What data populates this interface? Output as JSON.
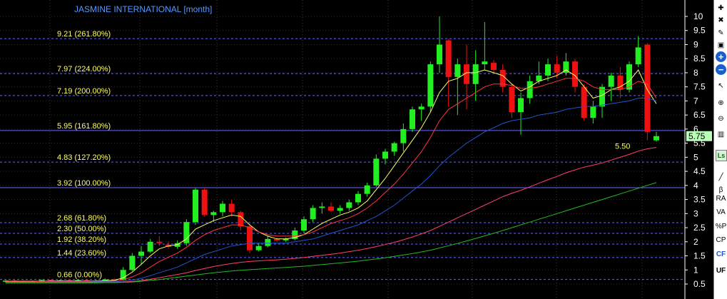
{
  "chart_data": {
    "type": "candlestick",
    "title": "JASMINE INTERNATIONAL [month]",
    "ylim": [
      0.3,
      10.4
    ],
    "y_ticks": [
      0.5,
      1,
      1.5,
      2,
      2.5,
      3,
      3.5,
      4,
      4.5,
      5,
      5.5,
      6,
      6.5,
      7,
      7.5,
      8,
      8.5,
      9,
      9.5,
      10
    ],
    "grid": true,
    "last_price": 5.75,
    "marker_label": "5.50",
    "fib_levels": [
      {
        "value": 9.21,
        "label": "9.21 (261.80%)"
      },
      {
        "value": 7.97,
        "label": "7.97 (224.00%)"
      },
      {
        "value": 7.19,
        "label": "7.19 (200.00%)"
      },
      {
        "value": 5.95,
        "label": "5.95 (161.80%)"
      },
      {
        "value": 4.83,
        "label": "4.83 (127.20%)"
      },
      {
        "value": 3.92,
        "label": "3.92 (100.00%)"
      },
      {
        "value": 2.68,
        "label": "2.68 (61.80%)"
      },
      {
        "value": 2.3,
        "label": "2.30 (50.00%)"
      },
      {
        "value": 1.92,
        "label": "1.92 (38.20%)"
      },
      {
        "value": 1.44,
        "label": "1.44 (23.60%)"
      },
      {
        "value": 0.66,
        "label": "0.66 (0.00%)"
      }
    ],
    "candles": [
      {
        "o": 0.58,
        "h": 0.64,
        "l": 0.54,
        "c": 0.62
      },
      {
        "o": 0.62,
        "h": 0.66,
        "l": 0.56,
        "c": 0.58
      },
      {
        "o": 0.58,
        "h": 0.62,
        "l": 0.55,
        "c": 0.6
      },
      {
        "o": 0.6,
        "h": 0.63,
        "l": 0.56,
        "c": 0.57
      },
      {
        "o": 0.57,
        "h": 0.66,
        "l": 0.55,
        "c": 0.64
      },
      {
        "o": 0.64,
        "h": 0.66,
        "l": 0.58,
        "c": 0.6
      },
      {
        "o": 0.6,
        "h": 0.65,
        "l": 0.57,
        "c": 0.63
      },
      {
        "o": 0.63,
        "h": 0.67,
        "l": 0.56,
        "c": 0.58
      },
      {
        "o": 0.58,
        "h": 0.66,
        "l": 0.55,
        "c": 0.64
      },
      {
        "o": 0.64,
        "h": 0.66,
        "l": 0.58,
        "c": 0.61
      },
      {
        "o": 0.61,
        "h": 0.65,
        "l": 0.56,
        "c": 0.62
      },
      {
        "o": 0.62,
        "h": 0.7,
        "l": 0.58,
        "c": 0.66
      },
      {
        "o": 0.66,
        "h": 0.7,
        "l": 0.6,
        "c": 0.64
      },
      {
        "o": 0.64,
        "h": 1.1,
        "l": 0.62,
        "c": 1.0
      },
      {
        "o": 1.0,
        "h": 1.6,
        "l": 0.95,
        "c": 1.5
      },
      {
        "o": 1.5,
        "h": 1.85,
        "l": 1.2,
        "c": 1.65
      },
      {
        "o": 1.65,
        "h": 2.1,
        "l": 1.6,
        "c": 2.0
      },
      {
        "o": 2.0,
        "h": 2.2,
        "l": 1.85,
        "c": 1.95
      },
      {
        "o": 1.9,
        "h": 2.0,
        "l": 1.75,
        "c": 1.82
      },
      {
        "o": 1.82,
        "h": 2.05,
        "l": 1.75,
        "c": 1.95
      },
      {
        "o": 1.95,
        "h": 2.8,
        "l": 1.85,
        "c": 2.7
      },
      {
        "o": 2.7,
        "h": 3.9,
        "l": 2.6,
        "c": 3.85
      },
      {
        "o": 3.85,
        "h": 3.9,
        "l": 2.9,
        "c": 2.95
      },
      {
        "o": 2.95,
        "h": 3.1,
        "l": 2.7,
        "c": 3.05
      },
      {
        "o": 3.05,
        "h": 3.45,
        "l": 2.9,
        "c": 3.35
      },
      {
        "o": 3.35,
        "h": 3.5,
        "l": 2.9,
        "c": 3.05
      },
      {
        "o": 3.05,
        "h": 3.1,
        "l": 2.4,
        "c": 2.55
      },
      {
        "o": 2.55,
        "h": 2.65,
        "l": 1.6,
        "c": 1.7
      },
      {
        "o": 1.7,
        "h": 1.95,
        "l": 1.65,
        "c": 1.85
      },
      {
        "o": 1.85,
        "h": 2.2,
        "l": 1.8,
        "c": 2.1
      },
      {
        "o": 2.1,
        "h": 2.15,
        "l": 2.0,
        "c": 2.05
      },
      {
        "o": 2.05,
        "h": 2.15,
        "l": 2.0,
        "c": 2.1
      },
      {
        "o": 2.1,
        "h": 2.5,
        "l": 2.05,
        "c": 2.4
      },
      {
        "o": 2.4,
        "h": 2.9,
        "l": 2.3,
        "c": 2.8
      },
      {
        "o": 2.8,
        "h": 3.3,
        "l": 2.7,
        "c": 3.2
      },
      {
        "o": 3.2,
        "h": 3.4,
        "l": 3.0,
        "c": 3.25
      },
      {
        "o": 3.25,
        "h": 3.4,
        "l": 3.05,
        "c": 3.1
      },
      {
        "o": 3.1,
        "h": 3.3,
        "l": 3.0,
        "c": 3.2
      },
      {
        "o": 3.2,
        "h": 3.5,
        "l": 3.1,
        "c": 3.4
      },
      {
        "o": 3.4,
        "h": 3.8,
        "l": 3.3,
        "c": 3.7
      },
      {
        "o": 3.7,
        "h": 4.1,
        "l": 3.6,
        "c": 4.0
      },
      {
        "o": 4.0,
        "h": 5.1,
        "l": 3.95,
        "c": 4.95
      },
      {
        "o": 4.95,
        "h": 5.3,
        "l": 4.75,
        "c": 5.2
      },
      {
        "o": 5.2,
        "h": 5.55,
        "l": 5.05,
        "c": 5.5
      },
      {
        "o": 5.5,
        "h": 6.2,
        "l": 5.2,
        "c": 6.0
      },
      {
        "o": 6.0,
        "h": 6.8,
        "l": 5.9,
        "c": 6.7
      },
      {
        "o": 6.7,
        "h": 6.9,
        "l": 6.3,
        "c": 6.8
      },
      {
        "o": 6.8,
        "h": 8.4,
        "l": 6.6,
        "c": 8.3
      },
      {
        "o": 8.3,
        "h": 10.0,
        "l": 8.0,
        "c": 9.0
      },
      {
        "o": 9.15,
        "h": 9.2,
        "l": 6.8,
        "c": 7.85
      },
      {
        "o": 7.85,
        "h": 8.5,
        "l": 6.5,
        "c": 8.3
      },
      {
        "o": 8.3,
        "h": 9.0,
        "l": 6.7,
        "c": 7.6
      },
      {
        "o": 7.6,
        "h": 8.8,
        "l": 7.0,
        "c": 8.3
      },
      {
        "o": 8.3,
        "h": 9.8,
        "l": 8.1,
        "c": 8.4
      },
      {
        "o": 8.35,
        "h": 8.45,
        "l": 8.0,
        "c": 8.1
      },
      {
        "o": 8.1,
        "h": 8.3,
        "l": 7.3,
        "c": 7.5
      },
      {
        "o": 7.5,
        "h": 7.6,
        "l": 6.4,
        "c": 6.6
      },
      {
        "o": 6.6,
        "h": 7.3,
        "l": 5.8,
        "c": 7.1
      },
      {
        "o": 7.1,
        "h": 7.9,
        "l": 6.9,
        "c": 7.7
      },
      {
        "o": 7.7,
        "h": 8.4,
        "l": 7.6,
        "c": 7.9
      },
      {
        "o": 7.9,
        "h": 8.5,
        "l": 7.7,
        "c": 8.3
      },
      {
        "o": 8.3,
        "h": 8.6,
        "l": 7.8,
        "c": 8.0
      },
      {
        "o": 8.0,
        "h": 8.7,
        "l": 7.9,
        "c": 8.4
      },
      {
        "o": 8.4,
        "h": 8.5,
        "l": 7.3,
        "c": 7.5
      },
      {
        "o": 7.5,
        "h": 7.6,
        "l": 6.3,
        "c": 6.4
      },
      {
        "o": 6.4,
        "h": 7.0,
        "l": 6.2,
        "c": 6.8
      },
      {
        "o": 6.8,
        "h": 7.6,
        "l": 6.4,
        "c": 7.5
      },
      {
        "o": 7.5,
        "h": 8.0,
        "l": 7.0,
        "c": 7.9
      },
      {
        "o": 7.9,
        "h": 8.2,
        "l": 7.1,
        "c": 7.4
      },
      {
        "o": 7.4,
        "h": 8.4,
        "l": 7.3,
        "c": 8.3
      },
      {
        "o": 8.3,
        "h": 9.3,
        "l": 8.2,
        "c": 8.9
      },
      {
        "o": 9.0,
        "h": 9.05,
        "l": 5.6,
        "c": 5.9
      },
      {
        "o": 5.6,
        "h": 5.9,
        "l": 5.55,
        "c": 5.75
      }
    ],
    "ma_series": [
      {
        "color": "#ffff66",
        "values": [
          0.6,
          0.6,
          0.6,
          0.6,
          0.6,
          0.61,
          0.61,
          0.61,
          0.61,
          0.61,
          0.61,
          0.62,
          0.63,
          0.72,
          0.92,
          1.2,
          1.5,
          1.75,
          1.85,
          1.9,
          2.1,
          2.45,
          2.6,
          2.75,
          2.85,
          2.95,
          2.9,
          2.6,
          2.35,
          2.2,
          2.1,
          2.1,
          2.15,
          2.25,
          2.45,
          2.65,
          2.8,
          2.95,
          3.05,
          3.2,
          3.45,
          3.85,
          4.25,
          4.7,
          5.15,
          5.6,
          6.05,
          6.6,
          7.3,
          7.7,
          7.8,
          8.0,
          8.0,
          8.1,
          8.0,
          7.9,
          7.6,
          7.35,
          7.5,
          7.7,
          7.8,
          7.9,
          8.1,
          7.9,
          7.5,
          7.1,
          7.2,
          7.4,
          7.5,
          7.7,
          8.1,
          7.4,
          6.9
        ]
      },
      {
        "color": "#ff3344",
        "values": [
          0.58,
          0.58,
          0.58,
          0.58,
          0.59,
          0.59,
          0.59,
          0.59,
          0.59,
          0.6,
          0.6,
          0.6,
          0.61,
          0.65,
          0.75,
          0.9,
          1.1,
          1.3,
          1.45,
          1.6,
          1.8,
          2.05,
          2.25,
          2.4,
          2.5,
          2.6,
          2.6,
          2.5,
          2.35,
          2.25,
          2.2,
          2.2,
          2.2,
          2.25,
          2.35,
          2.5,
          2.65,
          2.75,
          2.85,
          3.0,
          3.2,
          3.45,
          3.75,
          4.05,
          4.4,
          4.8,
          5.2,
          5.7,
          6.3,
          6.7,
          6.9,
          7.1,
          7.3,
          7.5,
          7.6,
          7.6,
          7.55,
          7.45,
          7.45,
          7.5,
          7.6,
          7.7,
          7.8,
          7.8,
          7.7,
          7.5,
          7.4,
          7.4,
          7.4,
          7.5,
          7.7,
          7.6,
          7.1
        ]
      },
      {
        "color": "#2255cc",
        "values": [
          0.56,
          0.56,
          0.56,
          0.56,
          0.56,
          0.57,
          0.57,
          0.57,
          0.57,
          0.57,
          0.58,
          0.58,
          0.58,
          0.6,
          0.64,
          0.7,
          0.8,
          0.9,
          1.0,
          1.1,
          1.25,
          1.4,
          1.55,
          1.65,
          1.75,
          1.85,
          1.9,
          1.95,
          1.95,
          1.95,
          1.95,
          1.95,
          2.0,
          2.05,
          2.1,
          2.2,
          2.3,
          2.4,
          2.5,
          2.6,
          2.75,
          2.9,
          3.1,
          3.3,
          3.55,
          3.8,
          4.05,
          4.35,
          4.7,
          5.0,
          5.25,
          5.5,
          5.7,
          5.9,
          6.05,
          6.2,
          6.3,
          6.35,
          6.4,
          6.5,
          6.55,
          6.6,
          6.7,
          6.75,
          6.8,
          6.8,
          6.85,
          6.9,
          6.95,
          7.0,
          7.1,
          7.1,
          7.0
        ]
      },
      {
        "color": "#ff4070",
        "values": [
          0.55,
          0.55,
          0.55,
          0.55,
          0.55,
          0.55,
          0.55,
          0.55,
          0.55,
          0.56,
          0.56,
          0.56,
          0.56,
          0.57,
          0.59,
          0.62,
          0.67,
          0.72,
          0.78,
          0.84,
          0.9,
          0.98,
          1.05,
          1.12,
          1.18,
          1.23,
          1.27,
          1.3,
          1.32,
          1.34,
          1.36,
          1.38,
          1.41,
          1.44,
          1.48,
          1.52,
          1.56,
          1.6,
          1.65,
          1.7,
          1.76,
          1.83,
          1.9,
          1.98,
          2.07,
          2.17,
          2.28,
          2.4,
          2.55,
          2.7,
          2.85,
          3.0,
          3.15,
          3.3,
          3.45,
          3.6,
          3.72,
          3.83,
          3.95,
          4.08,
          4.2,
          4.32,
          4.45,
          4.55,
          4.65,
          4.72,
          4.8,
          4.9,
          5.0,
          5.1,
          5.22,
          5.3,
          5.35
        ]
      },
      {
        "color": "#22bb22",
        "values": [
          0.54,
          0.54,
          0.54,
          0.54,
          0.54,
          0.54,
          0.54,
          0.54,
          0.54,
          0.54,
          0.54,
          0.55,
          0.55,
          0.56,
          0.57,
          0.6,
          0.63,
          0.66,
          0.7,
          0.74,
          0.78,
          0.82,
          0.86,
          0.9,
          0.93,
          0.96,
          0.99,
          1.01,
          1.03,
          1.05,
          1.07,
          1.09,
          1.11,
          1.13,
          1.16,
          1.19,
          1.22,
          1.25,
          1.28,
          1.31,
          1.35,
          1.39,
          1.43,
          1.48,
          1.53,
          1.58,
          1.64,
          1.7,
          1.78,
          1.86,
          1.94,
          2.03,
          2.12,
          2.21,
          2.3,
          2.4,
          2.5,
          2.6,
          2.7,
          2.8,
          2.9,
          3.0,
          3.1,
          3.2,
          3.3,
          3.4,
          3.5,
          3.6,
          3.7,
          3.8,
          3.9,
          4.0,
          4.1
        ]
      }
    ]
  },
  "colors": {
    "up": "#22ee22",
    "down": "#ee1111",
    "fib": "#6666ff",
    "text": "#ffff66",
    "axis": "#ffffff",
    "title": "#5599ff"
  },
  "toolbar": [
    {
      "name": "add-chart-icon",
      "glyph": "✚"
    },
    {
      "name": "delete-icon",
      "glyph": "✖"
    },
    {
      "name": "settings-icon",
      "glyph": "✎"
    },
    {
      "name": "new-window-icon",
      "glyph": "▣"
    },
    {
      "name": "zoom-in-button",
      "glyph": "+"
    },
    {
      "name": "zoom-out-button",
      "glyph": "−"
    },
    {
      "name": "cursor-menu-icon",
      "glyph": "↖"
    },
    {
      "name": "magnifier-plus-icon",
      "glyph": "⊕"
    },
    {
      "name": "magnifier-minus-icon",
      "glyph": "⊖"
    },
    {
      "name": "chart-type-icon",
      "glyph": "▥"
    },
    {
      "name": "ls-icon",
      "glyph": "Ls"
    },
    {
      "name": "line-tool-icon",
      "glyph": "╱"
    },
    {
      "name": "beta-icon",
      "glyph": "β"
    },
    {
      "name": "ra-label",
      "glyph": "RA"
    },
    {
      "name": "va-label",
      "glyph": "VA"
    },
    {
      "name": "percent-p-label",
      "glyph": "%P"
    },
    {
      "name": "cp-label",
      "glyph": "CP"
    },
    {
      "name": "cf-label",
      "glyph": "CF"
    },
    {
      "name": "uf-label",
      "glyph": "UF"
    }
  ]
}
